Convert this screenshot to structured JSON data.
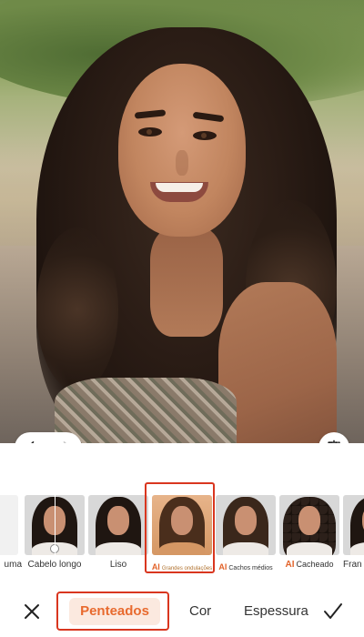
{
  "editor": {
    "undo_icon": "undo-icon",
    "redo_icon": "redo-icon",
    "compare_icon": "compare-icon"
  },
  "styles": {
    "items": [
      {
        "label": "uma",
        "ai": false
      },
      {
        "label": "Cabelo longo",
        "ai": false
      },
      {
        "label": "Liso",
        "ai": false
      },
      {
        "label": "Grandes ondulações",
        "ai": true,
        "selected": true
      },
      {
        "label": "Cachos médios",
        "ai": true
      },
      {
        "label": "Cacheado",
        "ai": true
      },
      {
        "label": "Fran",
        "ai": false
      }
    ],
    "ai_badge": "AI"
  },
  "tabs": {
    "items": [
      "Penteados",
      "Cor",
      "Espessura"
    ],
    "active": "Penteados"
  },
  "actions": {
    "close_icon": "close-icon",
    "confirm_icon": "check-icon"
  },
  "colors": {
    "accent": "#e86a2e",
    "accent_bg": "#fbe9df",
    "highlight_box": "#d9361f"
  }
}
